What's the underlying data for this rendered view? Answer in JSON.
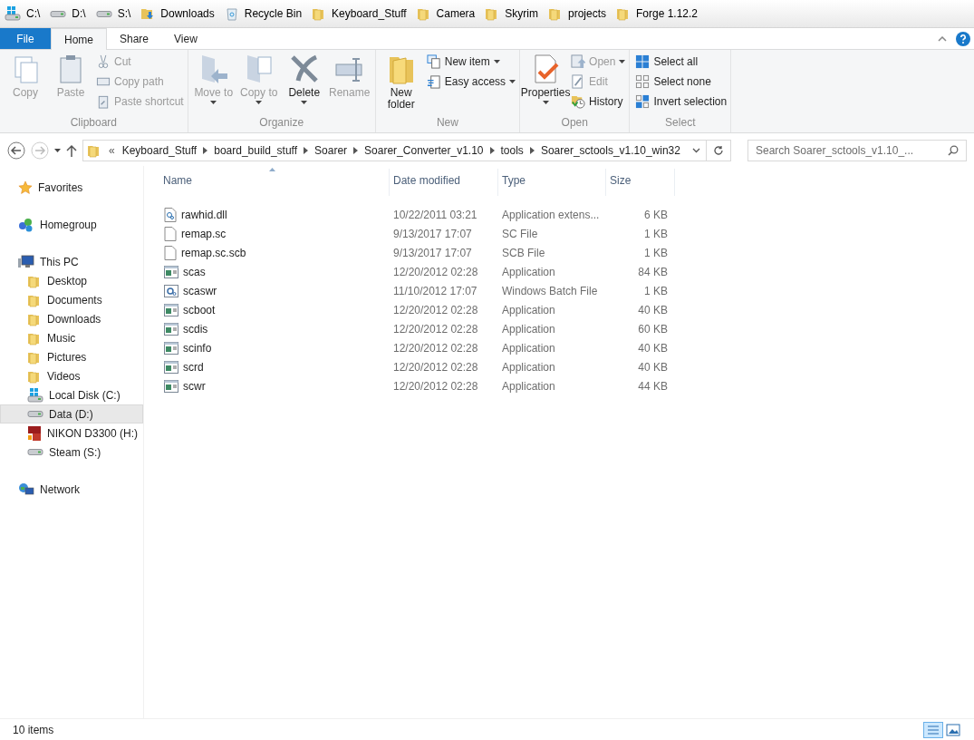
{
  "quick_bar": [
    {
      "label": "C:\\",
      "kind": "system-drive"
    },
    {
      "label": "D:\\",
      "kind": "drive"
    },
    {
      "label": "S:\\",
      "kind": "drive"
    },
    {
      "label": "Downloads",
      "kind": "download-folder"
    },
    {
      "label": "Recycle Bin",
      "kind": "bin"
    },
    {
      "label": "Keyboard_Stuff",
      "kind": "folder"
    },
    {
      "label": "Camera",
      "kind": "folder"
    },
    {
      "label": "Skyrim",
      "kind": "folder"
    },
    {
      "label": "projects",
      "kind": "folder"
    },
    {
      "label": "Forge 1.12.2",
      "kind": "folder"
    }
  ],
  "ribbon_tabs": [
    {
      "label": "File",
      "kind": "file",
      "selected": false
    },
    {
      "label": "Home",
      "kind": "tab",
      "selected": true
    },
    {
      "label": "Share",
      "kind": "tab",
      "selected": false
    },
    {
      "label": "View",
      "kind": "tab",
      "selected": false
    }
  ],
  "ribbon_groups": [
    {
      "title": "Clipboard",
      "items": [
        {
          "kind": "large",
          "label": "Copy",
          "disabled": true,
          "dropdown": false
        },
        {
          "kind": "large",
          "label": "Paste",
          "disabled": true,
          "dropdown": false
        },
        {
          "kind": "small",
          "label": "Cut",
          "disabled": true,
          "dropdown": false
        },
        {
          "kind": "small",
          "label": "Copy path",
          "disabled": true,
          "dropdown": false
        },
        {
          "kind": "small",
          "label": "Paste shortcut",
          "disabled": true,
          "dropdown": false
        }
      ]
    },
    {
      "title": "Organize",
      "items": [
        {
          "kind": "large",
          "label": "Move to",
          "disabled": true,
          "dropdown": true
        },
        {
          "kind": "large",
          "label": "Copy to",
          "disabled": true,
          "dropdown": true
        },
        {
          "kind": "large",
          "label": "Delete",
          "disabled": false,
          "dropdown": true
        },
        {
          "kind": "large",
          "label": "Rename",
          "disabled": true,
          "dropdown": false
        }
      ]
    },
    {
      "title": "New",
      "items": [
        {
          "kind": "large",
          "label": "New folder",
          "disabled": false,
          "dropdown": false
        },
        {
          "kind": "small",
          "label": "New item",
          "disabled": false,
          "dropdown": true
        },
        {
          "kind": "small",
          "label": "Easy access",
          "disabled": false,
          "dropdown": true
        }
      ]
    },
    {
      "title": "Open",
      "items": [
        {
          "kind": "large",
          "label": "Properties",
          "disabled": false,
          "dropdown": true
        },
        {
          "kind": "small",
          "label": "Open",
          "disabled": true,
          "dropdown": true
        },
        {
          "kind": "small",
          "label": "Edit",
          "disabled": true,
          "dropdown": false
        },
        {
          "kind": "small",
          "label": "History",
          "disabled": false,
          "dropdown": false
        }
      ]
    },
    {
      "title": "Select",
      "items": [
        {
          "kind": "small",
          "label": "Select all",
          "disabled": false,
          "dropdown": false
        },
        {
          "kind": "small",
          "label": "Select none",
          "disabled": false,
          "dropdown": false
        },
        {
          "kind": "small",
          "label": "Invert selection",
          "disabled": false,
          "dropdown": false
        }
      ]
    }
  ],
  "address": {
    "overflow": "«",
    "path": [
      "Keyboard_Stuff",
      "board_build_stuff",
      "Soarer",
      "Soarer_Converter_v1.10",
      "tools",
      "Soarer_sctools_v1.10_win32"
    ]
  },
  "search": {
    "placeholder": "Search Soarer_sctools_v1.10_..."
  },
  "sidebar": [
    {
      "label": "Favorites",
      "kind": "favorites",
      "selected": false
    },
    {
      "label": "Homegroup",
      "kind": "homegroup",
      "selected": false
    },
    {
      "label": "This PC",
      "kind": "pc",
      "selected": false,
      "children": [
        {
          "label": "Desktop",
          "kind": "folder",
          "selected": false
        },
        {
          "label": "Documents",
          "kind": "folder",
          "selected": false
        },
        {
          "label": "Downloads",
          "kind": "folder",
          "selected": false
        },
        {
          "label": "Music",
          "kind": "folder",
          "selected": false
        },
        {
          "label": "Pictures",
          "kind": "folder",
          "selected": false
        },
        {
          "label": "Videos",
          "kind": "folder",
          "selected": false
        },
        {
          "label": "Local Disk (C:)",
          "kind": "system-drive",
          "selected": false
        },
        {
          "label": "Data (D:)",
          "kind": "drive",
          "selected": true
        },
        {
          "label": "NIKON D3300 (H:)",
          "kind": "card",
          "selected": false
        },
        {
          "label": "Steam (S:)",
          "kind": "drive",
          "selected": false
        }
      ]
    },
    {
      "label": "Network",
      "kind": "network",
      "selected": false
    }
  ],
  "table": {
    "columns": [
      "Name",
      "Date modified",
      "Type",
      "Size"
    ],
    "rows": [
      {
        "name": "rawhid.dll",
        "kind": "dll",
        "date": "10/22/2011 03:21",
        "type": "Application extens...",
        "size": "6 KB"
      },
      {
        "name": "remap.sc",
        "kind": "blank",
        "date": "9/13/2017 17:07",
        "type": "SC File",
        "size": "1 KB"
      },
      {
        "name": "remap.sc.scb",
        "kind": "blank",
        "date": "9/13/2017 17:07",
        "type": "SCB File",
        "size": "1 KB"
      },
      {
        "name": "scas",
        "kind": "app",
        "date": "12/20/2012 02:28",
        "type": "Application",
        "size": "84 KB"
      },
      {
        "name": "scaswr",
        "kind": "batch",
        "date": "11/10/2012 17:07",
        "type": "Windows Batch File",
        "size": "1 KB"
      },
      {
        "name": "scboot",
        "kind": "app",
        "date": "12/20/2012 02:28",
        "type": "Application",
        "size": "40 KB"
      },
      {
        "name": "scdis",
        "kind": "app",
        "date": "12/20/2012 02:28",
        "type": "Application",
        "size": "60 KB"
      },
      {
        "name": "scinfo",
        "kind": "app",
        "date": "12/20/2012 02:28",
        "type": "Application",
        "size": "40 KB"
      },
      {
        "name": "scrd",
        "kind": "app",
        "date": "12/20/2012 02:28",
        "type": "Application",
        "size": "40 KB"
      },
      {
        "name": "scwr",
        "kind": "app",
        "date": "12/20/2012 02:28",
        "type": "Application",
        "size": "44 KB"
      }
    ]
  },
  "status_bar": {
    "count": "10 items"
  }
}
